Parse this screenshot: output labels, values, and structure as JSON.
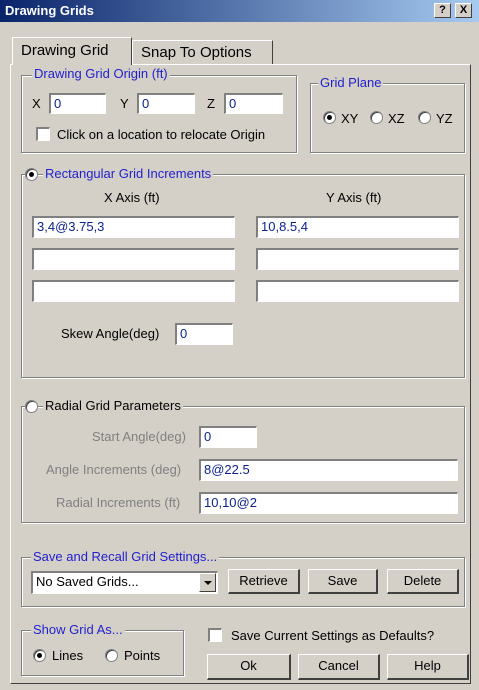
{
  "window": {
    "title": "Drawing Grids",
    "help_btn": "?",
    "close_btn": "X"
  },
  "tabs": [
    {
      "label": "Drawing Grid"
    },
    {
      "label": "Snap To Options"
    }
  ],
  "origin": {
    "legend": "Drawing Grid Origin (ft)",
    "x_label": "X",
    "x_value": "0",
    "y_label": "Y",
    "y_value": "0",
    "z_label": "Z",
    "z_value": "0",
    "relocate_label": "Click on a location to relocate Origin"
  },
  "plane": {
    "legend": "Grid Plane",
    "options": [
      "XY",
      "XZ",
      "YZ"
    ],
    "selected": "XY"
  },
  "rect": {
    "legend": "Rectangular Grid Increments",
    "x_header": "X Axis (ft)",
    "y_header": "Y Axis (ft)",
    "x_values": [
      "3,4@3.75,3",
      "",
      ""
    ],
    "y_values": [
      "10,8.5,4",
      "",
      ""
    ],
    "skew_label": "Skew Angle(deg)",
    "skew_value": "0"
  },
  "radial": {
    "legend": "Radial Grid Parameters",
    "start_label": "Start Angle(deg)",
    "start_value": "0",
    "angle_label": "Angle Increments (deg)",
    "angle_value": "8@22.5",
    "radial_label": "Radial Increments (ft)",
    "radial_value": "10,10@2"
  },
  "save_recall": {
    "legend": "Save and Recall Grid Settings...",
    "combo_value": "No Saved Grids...",
    "retrieve": "Retrieve",
    "save": "Save",
    "delete": "Delete"
  },
  "show_as": {
    "legend": "Show Grid As...",
    "lines": "Lines",
    "points": "Points",
    "selected": "Lines"
  },
  "defaults_label": "Save Current Settings as Defaults?",
  "buttons": {
    "ok": "Ok",
    "cancel": "Cancel",
    "help": "Help"
  }
}
